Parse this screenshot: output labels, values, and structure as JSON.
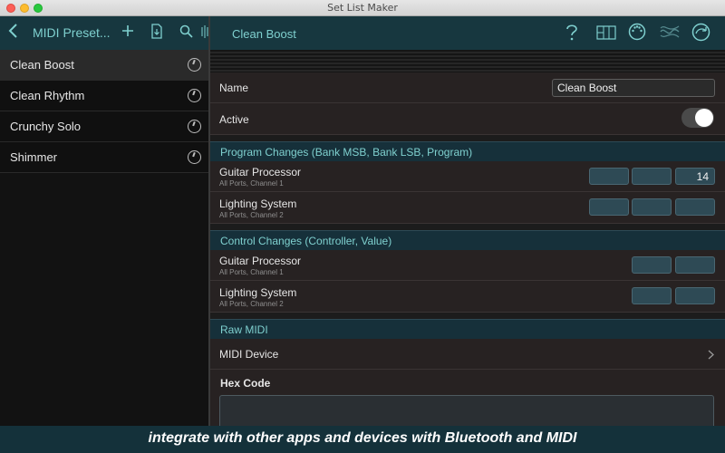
{
  "window": {
    "title": "Set List Maker"
  },
  "left": {
    "nav_title": "MIDI Preset...",
    "presets": [
      {
        "label": "Clean Boost",
        "selected": true
      },
      {
        "label": "Clean Rhythm",
        "selected": false
      },
      {
        "label": "Crunchy Solo",
        "selected": false
      },
      {
        "label": "Shimmer",
        "selected": false
      }
    ]
  },
  "detail": {
    "title": "Clean Boost",
    "name_label": "Name",
    "name_value": "Clean Boost",
    "active_label": "Active",
    "active_on": true,
    "program_changes": {
      "header": "Program Changes (Bank MSB, Bank LSB, Program)",
      "rows": [
        {
          "name": "Guitar Processor",
          "sub": "All Ports, Channel 1",
          "program": "14"
        },
        {
          "name": "Lighting System",
          "sub": "All Ports, Channel 2",
          "program": ""
        }
      ]
    },
    "control_changes": {
      "header": "Control Changes (Controller, Value)",
      "rows": [
        {
          "name": "Guitar Processor",
          "sub": "All Ports, Channel 1"
        },
        {
          "name": "Lighting System",
          "sub": "All Ports, Channel 2"
        }
      ]
    },
    "raw_midi": {
      "header": "Raw MIDI",
      "device_label": "MIDI Device",
      "hex_label": "Hex Code"
    }
  },
  "caption": "integrate with other apps and devices with Bluetooth and MIDI",
  "colors": {
    "accent": "#7fd0cf",
    "header_bg": "#17373f",
    "section_bg": "#16303a"
  }
}
